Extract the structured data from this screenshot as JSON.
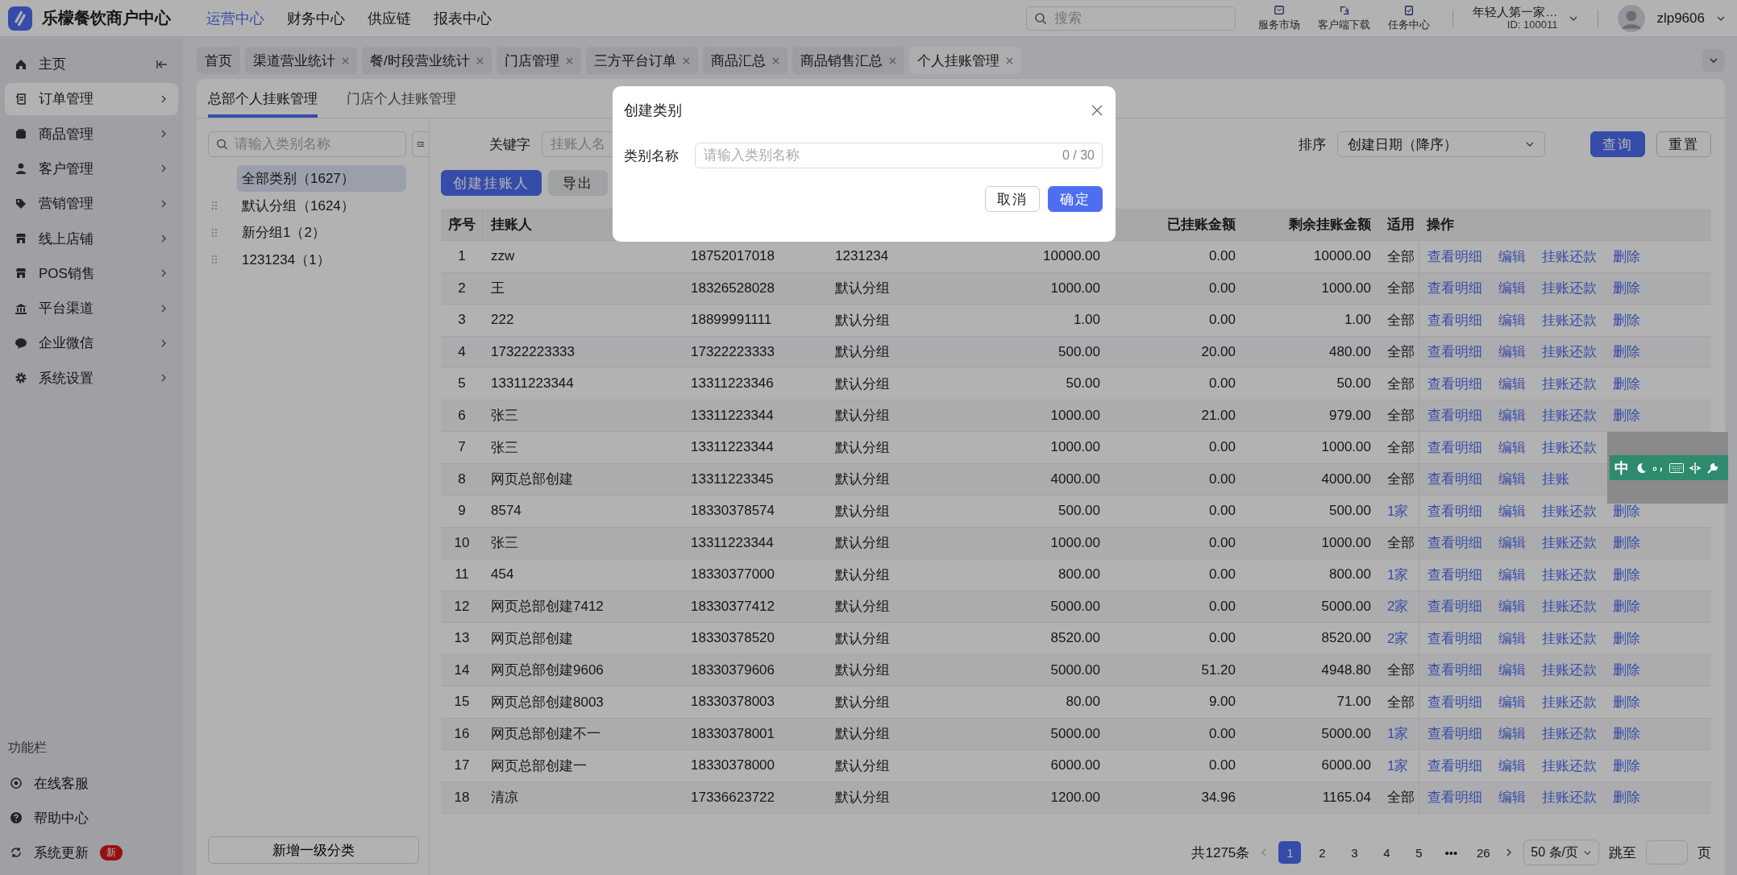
{
  "topbar": {
    "app_title": "乐檬餐饮商户中心",
    "nav": [
      {
        "label": "运营中心",
        "selected": true
      },
      {
        "label": "财务中心",
        "selected": false
      },
      {
        "label": "供应链",
        "selected": false
      },
      {
        "label": "报表中心",
        "selected": false
      }
    ],
    "search": {
      "placeholder": "搜索"
    },
    "tools": [
      {
        "label": "服务市场",
        "kind": "market"
      },
      {
        "label": "客户端下载",
        "kind": "download"
      },
      {
        "label": "任务中心",
        "kind": "task"
      }
    ],
    "org": {
      "name": "年轻人第一家…",
      "id": "ID: 100011"
    },
    "user": "zlp9606"
  },
  "sidebar": {
    "items": [
      {
        "label": "主页",
        "kind": "home",
        "selected": false
      },
      {
        "label": "订单管理",
        "kind": "order",
        "selected": true
      },
      {
        "label": "商品管理",
        "kind": "goods",
        "selected": false
      },
      {
        "label": "客户管理",
        "kind": "customer",
        "selected": false
      },
      {
        "label": "营销管理",
        "kind": "tag",
        "selected": false
      },
      {
        "label": "线上店铺",
        "kind": "shop",
        "selected": false
      },
      {
        "label": "POS销售",
        "kind": "shop",
        "selected": false
      },
      {
        "label": "平台渠道",
        "kind": "bank",
        "selected": false
      },
      {
        "label": "企业微信",
        "kind": "chat",
        "selected": false
      },
      {
        "label": "系统设置",
        "kind": "gear",
        "selected": false
      }
    ],
    "section_title": "功能栏",
    "tools": [
      {
        "label": "在线客服",
        "kind": "service"
      },
      {
        "label": "帮助中心",
        "kind": "help"
      },
      {
        "label": "系统更新",
        "kind": "update",
        "badge": "新"
      }
    ]
  },
  "tabs": [
    {
      "label": "首页",
      "closable": false,
      "selected": false
    },
    {
      "label": "渠道营业统计",
      "closable": true,
      "selected": false
    },
    {
      "label": "餐/时段营业统计",
      "closable": true,
      "selected": false
    },
    {
      "label": "门店管理",
      "closable": true,
      "selected": false
    },
    {
      "label": "三方平台订单",
      "closable": true,
      "selected": false
    },
    {
      "label": "商品汇总",
      "closable": true,
      "selected": false
    },
    {
      "label": "商品销售汇总",
      "closable": true,
      "selected": false
    },
    {
      "label": "个人挂账管理",
      "closable": true,
      "selected": true
    }
  ],
  "subtabs": [
    {
      "label": "总部个人挂账管理",
      "selected": true
    },
    {
      "label": "门店个人挂账管理",
      "selected": false
    }
  ],
  "category_panel": {
    "search": {
      "placeholder": "请输入类别名称"
    },
    "items": [
      {
        "label": "全部类别（1627）",
        "draggable": false,
        "selected": true
      },
      {
        "label": "默认分组（1624）",
        "draggable": true,
        "selected": false
      },
      {
        "label": "新分组1（2）",
        "draggable": true,
        "selected": false
      },
      {
        "label": "1231234（1）",
        "draggable": true,
        "selected": false
      }
    ],
    "add_button": "新增一级分类"
  },
  "filters": {
    "keyword_label": "关键字",
    "keyword_placeholder": "挂账人名",
    "sort_label": "排序",
    "sort_value": "创建日期（降序）",
    "query_button": "查询",
    "reset_button": "重置"
  },
  "actions": [
    "创建挂账人",
    "导出"
  ],
  "table": {
    "columns": [
      "序号",
      "挂账人",
      null,
      null,
      null,
      "已挂账金额",
      "剩余挂账金额",
      "适用",
      "操作"
    ],
    "rows": [
      {
        "no": "1",
        "name": "zzw",
        "phone": "18752017018",
        "group": "1231234",
        "limit": "10000.00",
        "used": "0.00",
        "remaining": "10000.00",
        "scope": {
          "text": "全部",
          "link": false
        },
        "ops": [
          "查看明细",
          "编辑",
          "挂账还款",
          "删除"
        ]
      },
      {
        "no": "2",
        "name": "王",
        "phone": "18326528028",
        "group": "默认分组",
        "limit": "1000.00",
        "used": "0.00",
        "remaining": "1000.00",
        "scope": {
          "text": "全部",
          "link": false
        },
        "ops": [
          "查看明细",
          "编辑",
          "挂账还款",
          "删除"
        ]
      },
      {
        "no": "3",
        "name": "222",
        "phone": "18899991111",
        "group": "默认分组",
        "limit": "1.00",
        "used": "0.00",
        "remaining": "1.00",
        "scope": {
          "text": "全部",
          "link": false
        },
        "ops": [
          "查看明细",
          "编辑",
          "挂账还款",
          "删除"
        ]
      },
      {
        "no": "4",
        "name": "17322223333",
        "phone": "17322223333",
        "group": "默认分组",
        "limit": "500.00",
        "used": "20.00",
        "remaining": "480.00",
        "scope": {
          "text": "全部",
          "link": false
        },
        "ops": [
          "查看明细",
          "编辑",
          "挂账还款",
          "删除"
        ]
      },
      {
        "no": "5",
        "name": "13311223344",
        "phone": "13311223346",
        "group": "默认分组",
        "limit": "50.00",
        "used": "0.00",
        "remaining": "50.00",
        "scope": {
          "text": "全部",
          "link": false
        },
        "ops": [
          "查看明细",
          "编辑",
          "挂账还款",
          "删除"
        ]
      },
      {
        "no": "6",
        "name": "张三",
        "phone": "13311223344",
        "group": "默认分组",
        "limit": "1000.00",
        "used": "21.00",
        "remaining": "979.00",
        "scope": {
          "text": "全部",
          "link": false
        },
        "ops": [
          "查看明细",
          "编辑",
          "挂账还款",
          "删除"
        ]
      },
      {
        "no": "7",
        "name": "张三",
        "phone": "13311223344",
        "group": "默认分组",
        "limit": "1000.00",
        "used": "0.00",
        "remaining": "1000.00",
        "scope": {
          "text": "全部",
          "link": false
        },
        "ops": [
          "查看明细",
          "编辑",
          "挂账还款"
        ]
      },
      {
        "no": "8",
        "name": "网页总部创建",
        "phone": "13311223345",
        "group": "默认分组",
        "limit": "4000.00",
        "used": "0.00",
        "remaining": "4000.00",
        "scope": {
          "text": "全部",
          "link": false
        },
        "ops": [
          "查看明细",
          "编辑",
          "挂账"
        ]
      },
      {
        "no": "9",
        "name": "8574",
        "phone": "18330378574",
        "group": "默认分组",
        "limit": "500.00",
        "used": "0.00",
        "remaining": "500.00",
        "scope": {
          "text": "1家",
          "link": true
        },
        "ops": [
          "查看明细",
          "编辑",
          "挂账还款",
          "删除"
        ]
      },
      {
        "no": "10",
        "name": "张三",
        "phone": "13311223344",
        "group": "默认分组",
        "limit": "1000.00",
        "used": "0.00",
        "remaining": "1000.00",
        "scope": {
          "text": "全部",
          "link": false
        },
        "ops": [
          "查看明细",
          "编辑",
          "挂账还款",
          "删除"
        ]
      },
      {
        "no": "11",
        "name": "454",
        "phone": "18330377000",
        "group": "默认分组",
        "limit": "800.00",
        "used": "0.00",
        "remaining": "800.00",
        "scope": {
          "text": "1家",
          "link": true
        },
        "ops": [
          "查看明细",
          "编辑",
          "挂账还款",
          "删除"
        ]
      },
      {
        "no": "12",
        "name": "网页总部创建7412",
        "phone": "18330377412",
        "group": "默认分组",
        "limit": "5000.00",
        "used": "0.00",
        "remaining": "5000.00",
        "scope": {
          "text": "2家",
          "link": true
        },
        "ops": [
          "查看明细",
          "编辑",
          "挂账还款",
          "删除"
        ]
      },
      {
        "no": "13",
        "name": "网页总部创建",
        "phone": "18330378520",
        "group": "默认分组",
        "limit": "8520.00",
        "used": "0.00",
        "remaining": "8520.00",
        "scope": {
          "text": "2家",
          "link": true
        },
        "ops": [
          "查看明细",
          "编辑",
          "挂账还款",
          "删除"
        ]
      },
      {
        "no": "14",
        "name": "网页总部创建9606",
        "phone": "18330379606",
        "group": "默认分组",
        "limit": "5000.00",
        "used": "51.20",
        "remaining": "4948.80",
        "scope": {
          "text": "全部",
          "link": false
        },
        "ops": [
          "查看明细",
          "编辑",
          "挂账还款",
          "删除"
        ]
      },
      {
        "no": "15",
        "name": "网页总部创建8003",
        "phone": "18330378003",
        "group": "默认分组",
        "limit": "80.00",
        "used": "9.00",
        "remaining": "71.00",
        "scope": {
          "text": "全部",
          "link": false
        },
        "ops": [
          "查看明细",
          "编辑",
          "挂账还款",
          "删除"
        ]
      },
      {
        "no": "16",
        "name": "网页总部创建不一",
        "phone": "18330378001",
        "group": "默认分组",
        "limit": "5000.00",
        "used": "0.00",
        "remaining": "5000.00",
        "scope": {
          "text": "1家",
          "link": true
        },
        "ops": [
          "查看明细",
          "编辑",
          "挂账还款",
          "删除"
        ]
      },
      {
        "no": "17",
        "name": "网页总部创建一",
        "phone": "18330378000",
        "group": "默认分组",
        "limit": "6000.00",
        "used": "0.00",
        "remaining": "6000.00",
        "scope": {
          "text": "1家",
          "link": true
        },
        "ops": [
          "查看明细",
          "编辑",
          "挂账还款",
          "删除"
        ]
      },
      {
        "no": "18",
        "name": "清凉",
        "phone": "17336623722",
        "group": "默认分组",
        "limit": "1200.00",
        "used": "34.96",
        "remaining": "1165.04",
        "scope": {
          "text": "全部",
          "link": false
        },
        "ops": [
          "查看明细",
          "编辑",
          "挂账还款",
          "删除"
        ]
      }
    ]
  },
  "pagination": {
    "total": "共1275条",
    "pages": [
      {
        "label": "1",
        "selected": true
      },
      {
        "label": "2",
        "selected": false
      },
      {
        "label": "3",
        "selected": false
      },
      {
        "label": "4",
        "selected": false
      },
      {
        "label": "5",
        "selected": false
      },
      {
        "label": "•••",
        "selected": false
      },
      {
        "label": "26",
        "selected": false
      }
    ],
    "page_size": "50 条/页",
    "jump_label": "跳至",
    "jump_suffix": "页"
  },
  "modal": {
    "title": "创建类别",
    "field_label": "类别名称",
    "placeholder": "请输入类别名称",
    "counter": "0 / 30",
    "cancel": "取消",
    "confirm": "确定"
  },
  "ime_toolbar": {
    "mode": "中"
  }
}
